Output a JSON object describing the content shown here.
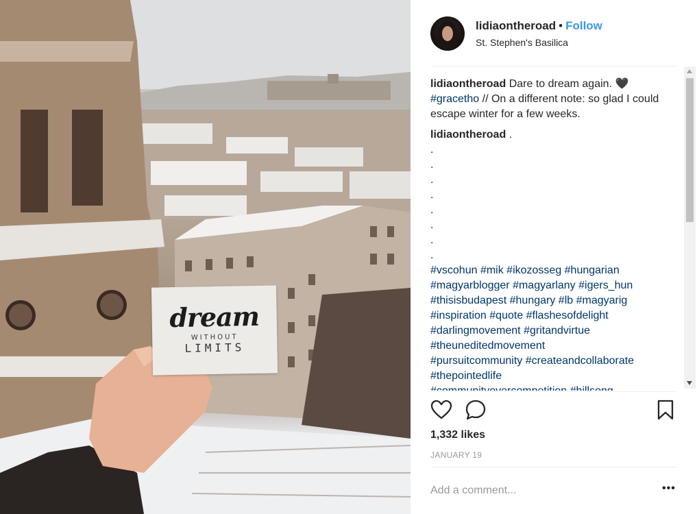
{
  "header": {
    "username": "lidiaontheroad",
    "separator": "•",
    "follow_label": "Follow",
    "location": "St. Stephen's Basilica"
  },
  "photo": {
    "card_line1": "dream",
    "card_line2": "WITHOUT",
    "card_line3": "LIMITS"
  },
  "comments": {
    "caption": {
      "username": "lidiaontheroad",
      "text_before": "Dare to dream again. ",
      "emoji": "🖤",
      "hashtag": "#gracetho",
      "text_after": " // On a different note: so glad I could escape winter for a few weeks."
    },
    "second": {
      "username": "lidiaontheroad",
      "text": " .",
      "dots": [
        ".",
        ".",
        ".",
        ".",
        ".",
        ".",
        ".",
        "."
      ],
      "hashtag_lines": [
        "#vscohun #mik #ikozosseg #hungarian",
        "#magyarblogger #magyarlany #igers_hun",
        "#thisisbudapest #hungary #lb #magyarig",
        "#inspiration #quote #flashesofdelight",
        "#darlingmovement #gritandvirtue",
        "#theuneditedmovement",
        "#pursuitcommunity #createandcollaborate",
        "#thepointedlife",
        "#communityovercompetition #hillsong"
      ]
    }
  },
  "actions": {
    "like_icon": "heart-icon",
    "comment_icon": "comment-bubble-icon",
    "save_icon": "bookmark-icon"
  },
  "likes": "1,332 likes",
  "date": "JANUARY 19",
  "add_comment": {
    "placeholder": "Add a comment...",
    "more_label": "•••"
  },
  "colors": {
    "follow": "#3897f0",
    "hashtag": "#003569",
    "muted": "#999999"
  }
}
